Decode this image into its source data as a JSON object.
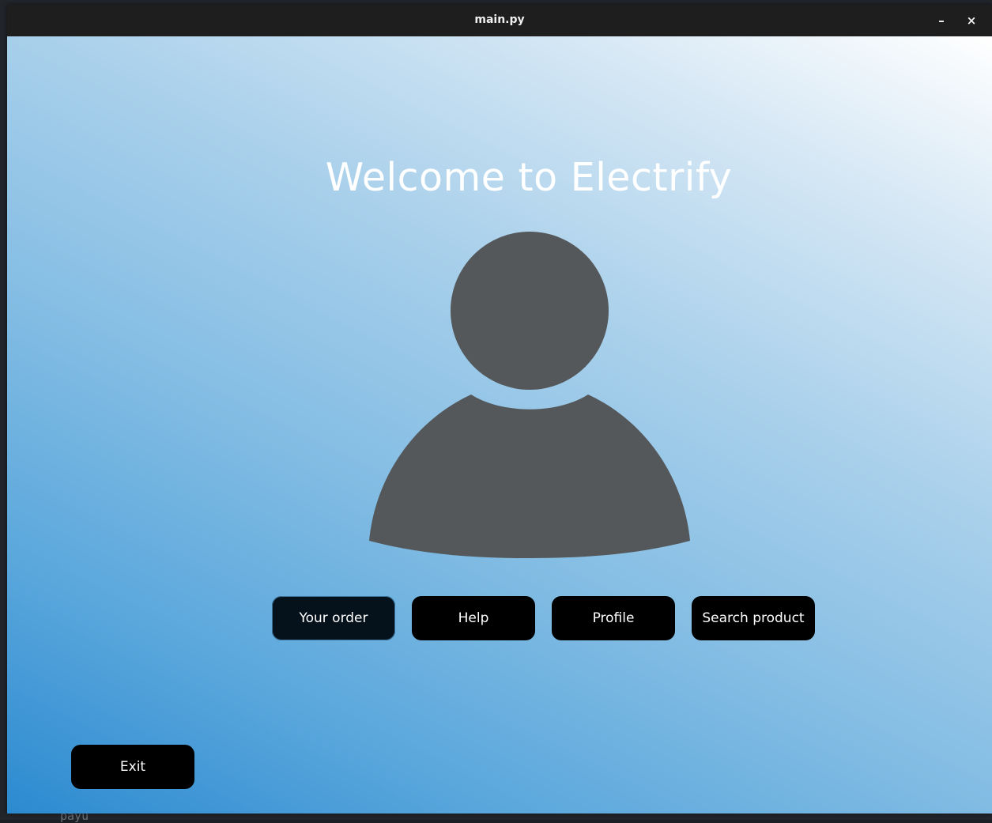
{
  "window": {
    "title": "main.py",
    "minimize_label": "–",
    "close_label": "×"
  },
  "background": {
    "partial_text": "payu"
  },
  "main": {
    "welcome_text": "Welcome to Electrify",
    "avatar_icon": "user-silhouette-icon",
    "avatar_color": "#54585a",
    "buttons": {
      "your_order": "Your order",
      "help": "Help",
      "profile": "Profile",
      "search_product": "Search product",
      "exit": "Exit"
    }
  },
  "colors": {
    "gradient_top_right": "#ffffff",
    "gradient_bottom_left": "#2c8ad0",
    "button_bg": "#000000",
    "button_text": "#ffffff"
  }
}
